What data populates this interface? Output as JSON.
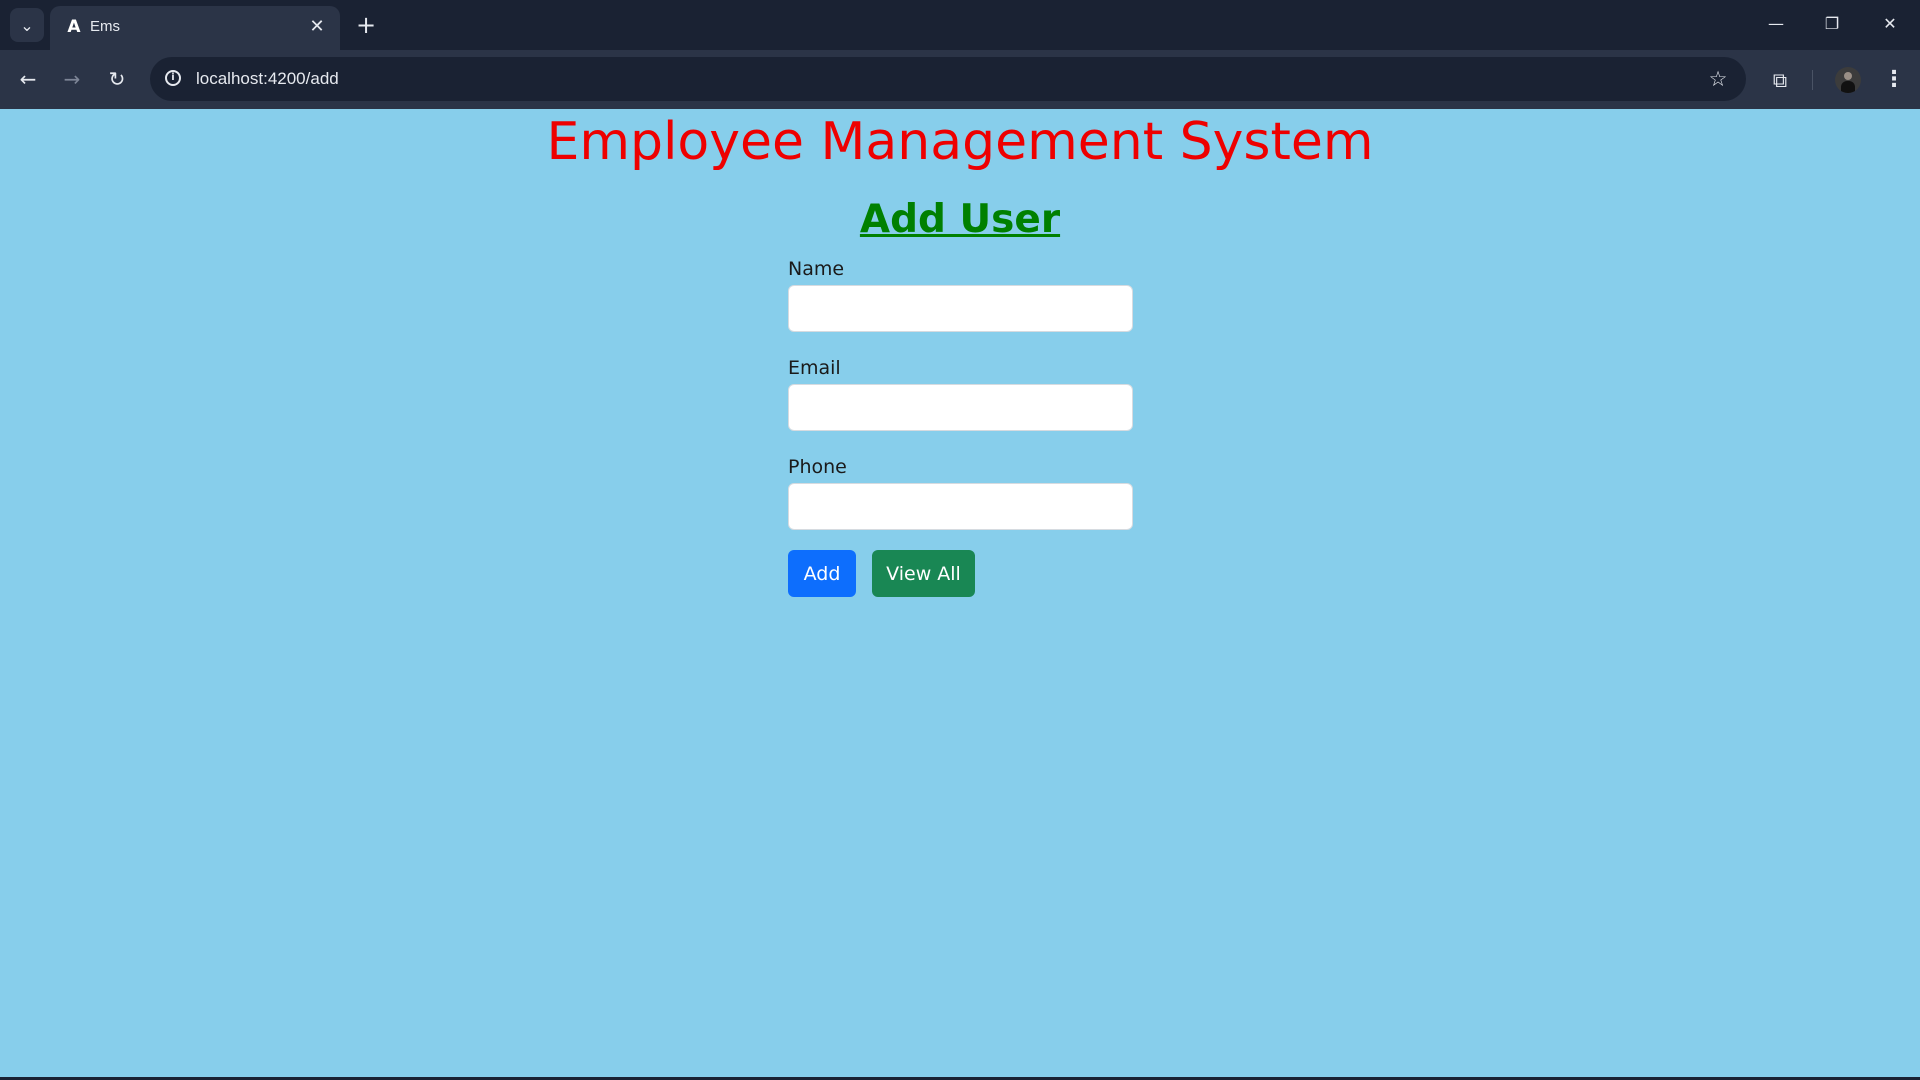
{
  "browser": {
    "tab_title": "Ems",
    "tab_favicon": "A",
    "url": "localhost:4200/add",
    "icons": {
      "tab_list": "chevron-down-icon",
      "tab_close": "close-icon",
      "new_tab": "plus-icon",
      "back": "arrow-left-icon",
      "forward": "arrow-right-icon",
      "reload": "reload-icon",
      "site_info": "info-icon",
      "bookmark": "star-icon",
      "extensions": "puzzle-icon",
      "menu": "more-vertical-icon",
      "minimize": "minimize-icon",
      "restore": "restore-icon",
      "close_window": "close-icon"
    }
  },
  "page": {
    "title": "Employee Management System",
    "subtitle": "Add User",
    "background": "#87ceeb",
    "title_color": "#ee0000",
    "subtitle_color": "#008000"
  },
  "form": {
    "fields": [
      {
        "label": "Name",
        "value": "",
        "placeholder": ""
      },
      {
        "label": "Email",
        "value": "",
        "placeholder": ""
      },
      {
        "label": "Phone",
        "value": "",
        "placeholder": ""
      }
    ],
    "add_label": "Add",
    "view_all_label": "View All",
    "add_color": "#0d6efd",
    "view_all_color": "#198754"
  }
}
